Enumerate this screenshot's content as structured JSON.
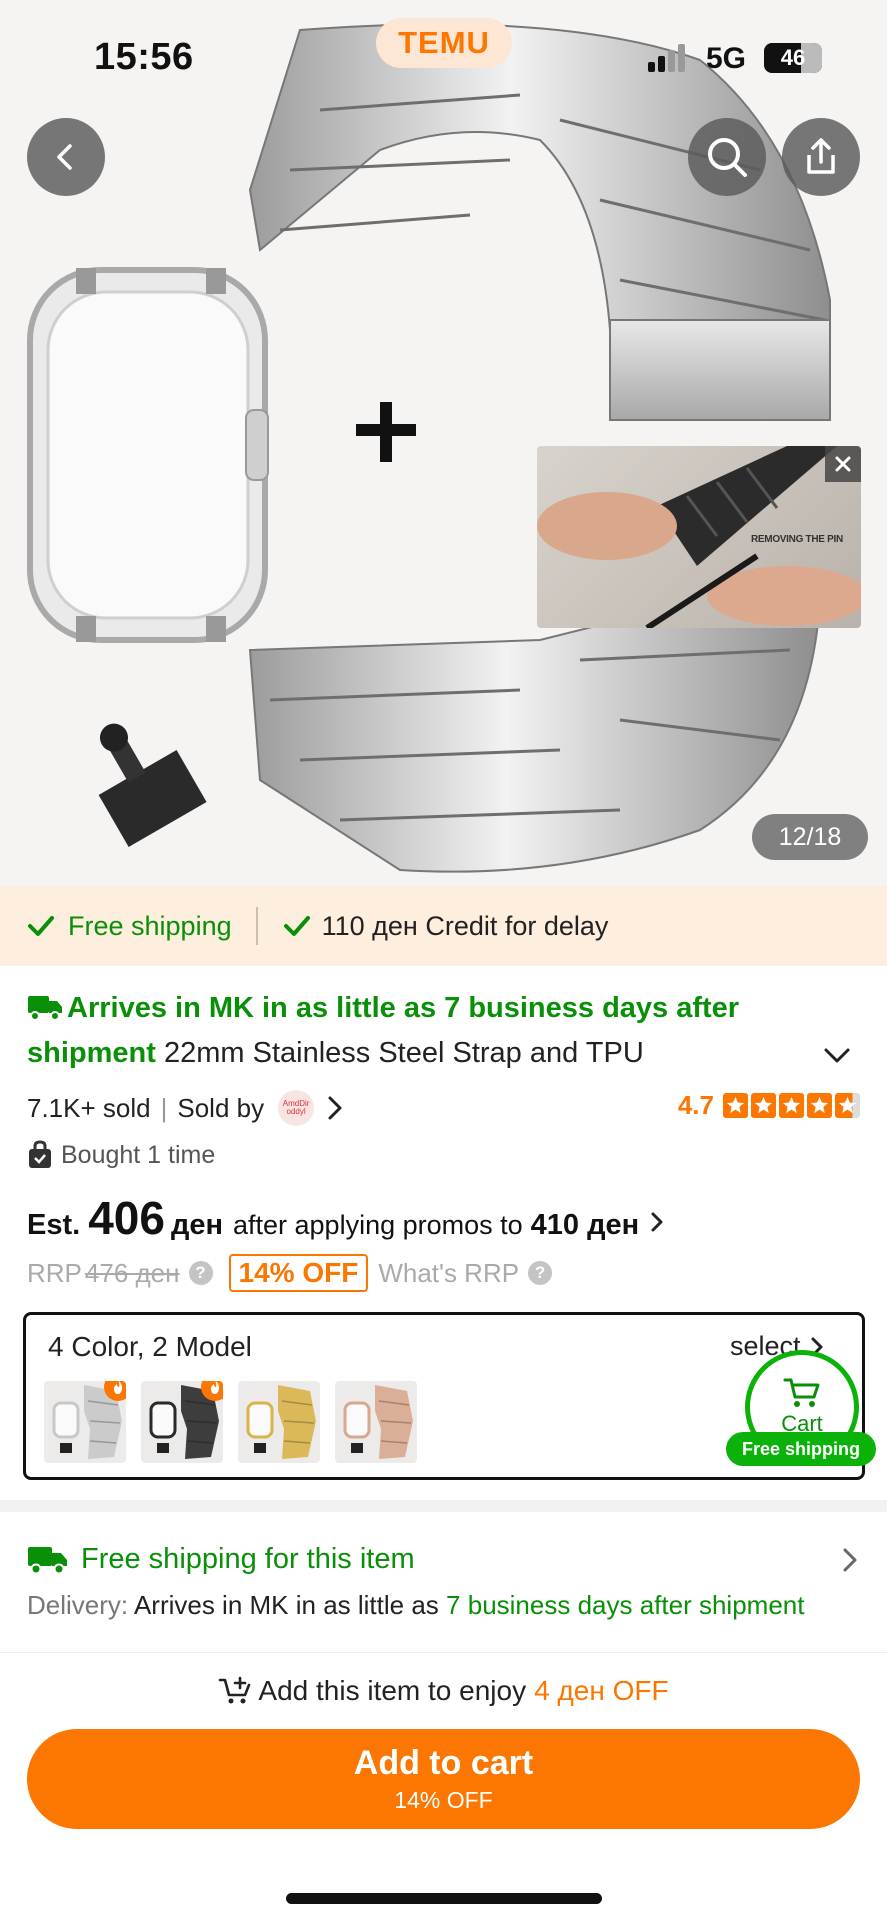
{
  "status": {
    "time": "15:56",
    "network": "5G",
    "battery": "46"
  },
  "header": {
    "brand": "TEMU"
  },
  "gallery": {
    "counter": "12/18",
    "video_caption": "REMOVING THE PIN"
  },
  "promo_strip": {
    "free_shipping": "Free shipping",
    "credit": "110 ден Credit for delay"
  },
  "product": {
    "arrive_green": "Arrives in MK in as little as  7 business days after shipment",
    "title": "22mm Stainless Steel Strap and TPU",
    "sold": "7.1K+ sold",
    "sold_by": "Sold by",
    "seller_logo_text": "AmdDir oddyl",
    "rating": "4.7",
    "bought": "Bought 1 time"
  },
  "price": {
    "est_label": "Est.",
    "amount": "406",
    "currency": "ден",
    "after_text": "after applying promos to",
    "promo_price": "410 ден",
    "rrp_label": "RRP",
    "rrp_old": "476 ден",
    "discount": "14% OFF",
    "whats_rrp": "What's RRP"
  },
  "variants": {
    "title": "4 Color, 2 Model",
    "select_label": "select",
    "swatches": [
      {
        "name": "silver",
        "color": "#c8c8c8",
        "hot": true
      },
      {
        "name": "black",
        "color": "#2a2a2a",
        "hot": true
      },
      {
        "name": "gold",
        "color": "#d9b24a",
        "hot": false
      },
      {
        "name": "rose-gold",
        "color": "#d9a78e",
        "hot": false
      }
    ]
  },
  "cart_float": {
    "label": "Cart",
    "badge": "Free shipping"
  },
  "shipping": {
    "title": "Free shipping for this item",
    "delivery_label": "Delivery:",
    "delivery_text": "Arrives in MK in as little as",
    "delivery_green": "7 business days after shipment"
  },
  "bottom": {
    "hint": "Add this item to enjoy",
    "hint_orange": "4 ден OFF",
    "button_main": "Add to cart",
    "button_sub": "14% OFF"
  },
  "colors": {
    "accent": "#fb7701",
    "green": "#0a8f08",
    "promo_bg": "#fdeede"
  },
  "icons": [
    "back-icon",
    "search-icon",
    "share-icon",
    "close-icon",
    "check-icon",
    "truck-icon",
    "bag-icon",
    "cart-icon",
    "chevron-right-icon",
    "chevron-down-icon",
    "star-icon",
    "question-icon",
    "fire-icon",
    "cart-plus-icon"
  ]
}
